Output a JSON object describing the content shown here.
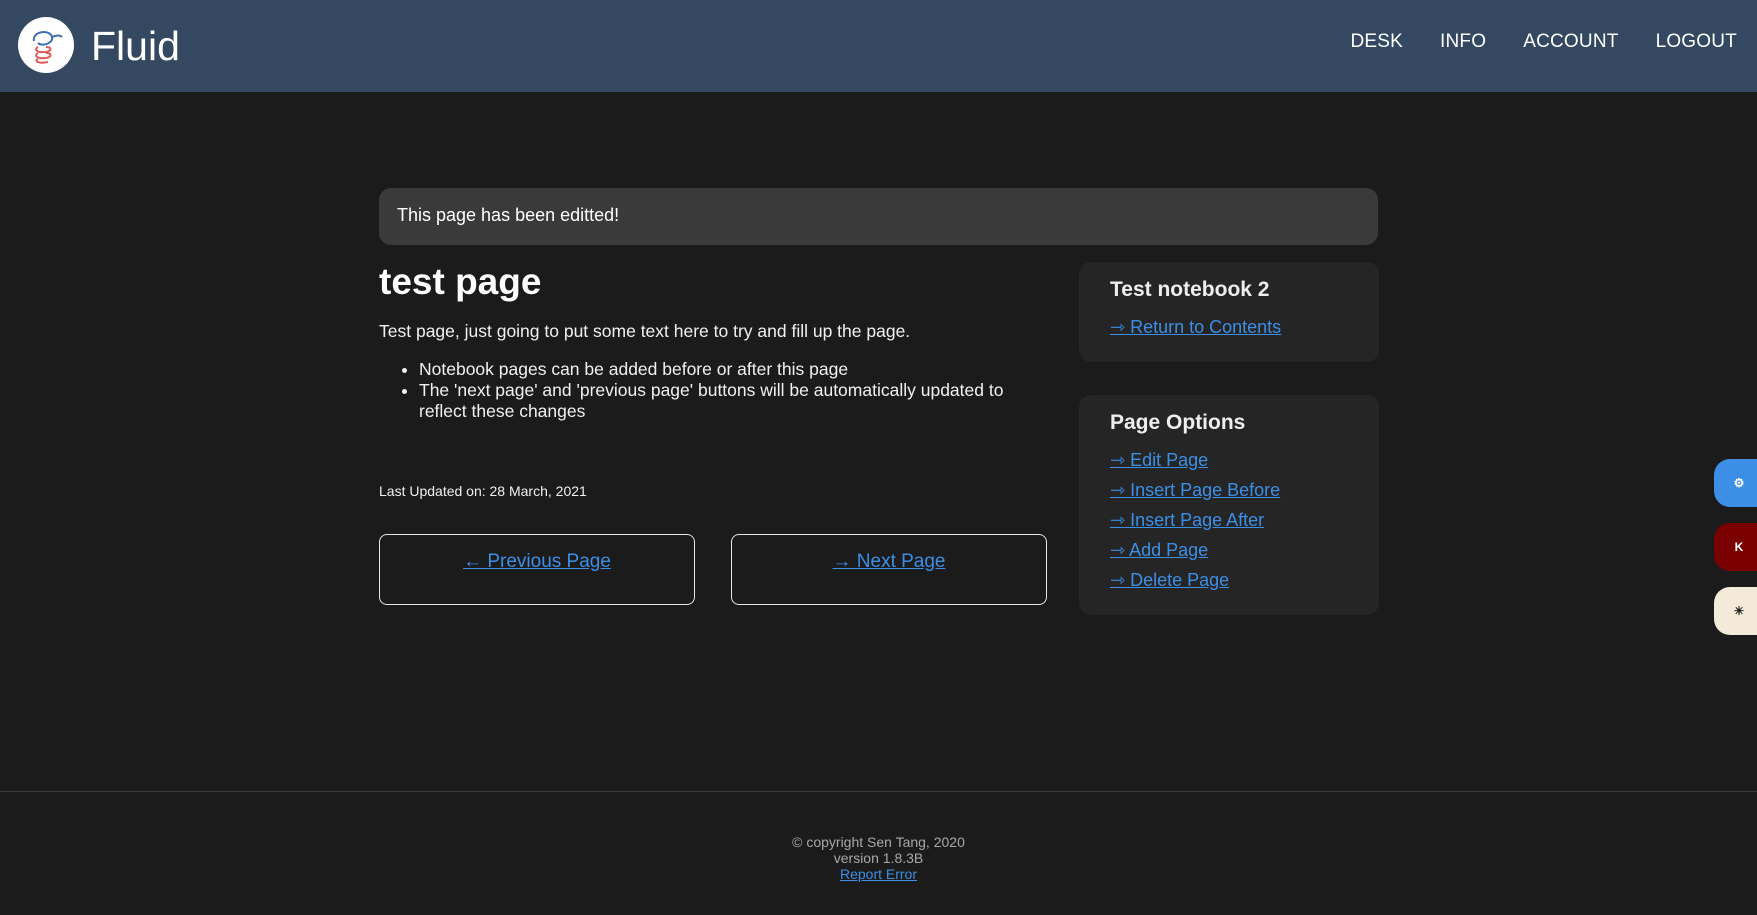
{
  "header": {
    "brand": "Fluid",
    "nav": [
      "DESK",
      "INFO",
      "ACCOUNT",
      "LOGOUT"
    ]
  },
  "alert": {
    "text": "This page has been editted!"
  },
  "page": {
    "title": "test page",
    "body": "Test page, just going to put some text here to try and fill up the page.",
    "bullets": [
      "Notebook pages can be added before or after this page",
      "The 'next page' and 'previous page' buttons will be automatically updated to reflect these changes"
    ],
    "last_updated": "Last Updated on: 28 March, 2021",
    "prev_label": "← Previous Page",
    "next_label": "→ Next Page"
  },
  "sidebar": {
    "notebook": {
      "title": "Test notebook 2",
      "links": [
        "⇾ Return to Contents"
      ]
    },
    "options": {
      "title": "Page Options",
      "links": [
        "⇾ Edit Page",
        "⇾ Insert Page Before",
        "⇾ Insert Page After",
        "⇾ Add Page",
        "⇾ Delete Page"
      ]
    }
  },
  "floating_buttons": [
    {
      "icon": "gear-icon",
      "glyph": "⚙",
      "color": "#3d8fe6"
    },
    {
      "icon": "k-icon",
      "glyph": "K",
      "color": "#7a0000"
    },
    {
      "icon": "sun-icon",
      "glyph": "☀",
      "color": "#f3ead9"
    }
  ],
  "footer": {
    "copyright": "© copyright Sen Tang, 2020",
    "version": "version 1.8.3B",
    "report": "Report Error"
  }
}
